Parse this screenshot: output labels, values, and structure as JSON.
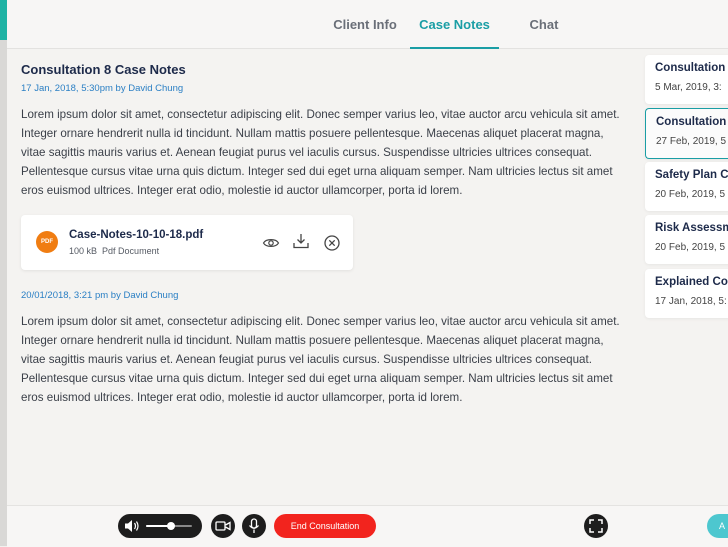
{
  "tabs": [
    {
      "label": "Client Info"
    },
    {
      "label": "Case Notes"
    },
    {
      "label": "Chat"
    }
  ],
  "note": {
    "title": "Consultation 8 Case Notes",
    "meta": "17 Jan,  2018, 5:30pm by David Chung",
    "body": "Lorem ipsum dolor sit amet, consectetur adipiscing elit. Donec semper varius leo, vitae auctor arcu vehicula sit amet. Integer ornare hendrerit nulla id tincidunt. Nullam mattis posuere pellentesque. Maecenas aliquet placerat magna, vitae sagittis mauris varius et. Aenean feugiat purus vel iaculis cursus. Suspendisse ultricies ultrices consequat. Pellentesque cursus vitae urna quis dictum. Integer sed dui eget urna aliquam semper. Nam ultricies lectus sit amet eros euismod ultrices. Integer erat odio, molestie id auctor ullamcorper, porta id lorem."
  },
  "attachment": {
    "badge": "PDF",
    "name": "Case-Notes-10-10-18.pdf",
    "size": "100 kB",
    "type": "Pdf Document"
  },
  "entry2": {
    "meta": "20/01/2018, 3:21 pm by David Chung",
    "body": "Lorem ipsum dolor sit amet, consectetur adipiscing elit. Donec semper varius leo, vitae auctor arcu vehicula sit amet. Integer ornare hendrerit nulla id tincidunt. Nullam mattis posuere pellentesque. Maecenas aliquet placerat magna, vitae sagittis mauris varius et. Aenean feugiat purus vel iaculis cursus. Suspendisse ultricies ultrices consequat. Pellentesque cursus vitae urna quis dictum. Integer sed dui eget urna aliquam semper. Nam ultricies lectus sit amet eros euismod ultrices. Integer erat odio, molestie id auctor ullamcorper, porta id lorem."
  },
  "list": [
    {
      "title": "Consultation",
      "date": "5 Mar, 2019, 3:"
    },
    {
      "title": "Consultation",
      "date": "27 Feb, 2019, 5"
    },
    {
      "title": "Safety Plan C",
      "date": "20 Feb, 2019, 5"
    },
    {
      "title": "Risk Assessm",
      "date": "20 Feb, 2019, 5"
    },
    {
      "title": "Explained Co",
      "date": "17 Jan, 2018, 5:"
    }
  ],
  "controls": {
    "end_label": "End Consultation",
    "accent_label": "A",
    "volume_level": 0.55
  },
  "colors": {
    "accent": "#1a9ea5",
    "end_button": "#f2241e",
    "pdf_badge": "#f07d12",
    "link_blue": "#2a7fc4"
  }
}
